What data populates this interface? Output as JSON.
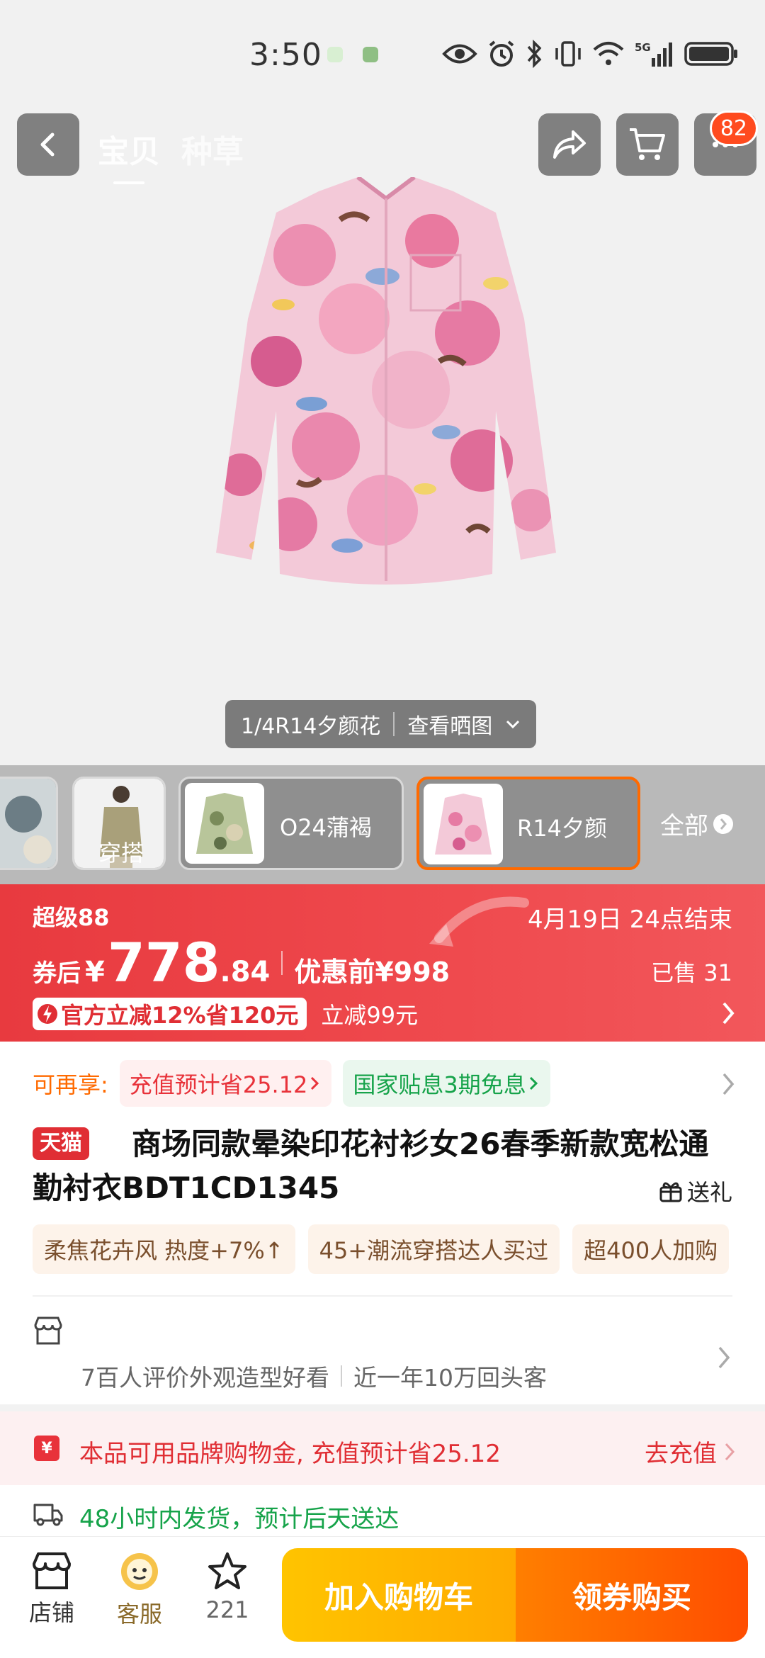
{
  "status_bar": {
    "time": "3:50",
    "network": "5G"
  },
  "top_nav": {
    "tabs": [
      "宝贝",
      "种草"
    ],
    "cart_badge": "82"
  },
  "gallery": {
    "indicator": "1/4R14夕颜花",
    "view_photos": "查看晒图"
  },
  "variants": {
    "items": [
      {
        "label": "穿搭"
      },
      {
        "label": "O24蒲褐"
      },
      {
        "label": "R14夕颜"
      }
    ],
    "all_label": "全部"
  },
  "price": {
    "promo_name": "超级88",
    "end_time": "4月19日 24点结束",
    "after_coupon": "券后",
    "currency": "¥",
    "integer": "778",
    "decimal": ".84",
    "before_discount": "优惠前¥998",
    "sold": "已售 31",
    "official_reduction": "官方立减12%省120元",
    "instant_reduction": "立减99元"
  },
  "offers": {
    "label": "可再享:",
    "chips": [
      "充值预计省25.12",
      "国家贴息3期免息"
    ]
  },
  "product": {
    "store_badge": "天猫",
    "title": "商场同款晕染印花衬衫女26春季新款宽松通勤衬衣BDT1CD1345",
    "gift_label": "送礼",
    "tags": [
      "柔焦花卉风 热度+7%↑",
      "45+潮流穿搭达人买过",
      "超400人加购"
    ]
  },
  "reviews": {
    "summary": "7百人评价外观造型好看",
    "repeat": "近一年10万回头客"
  },
  "recharge": {
    "icon_text": "¥",
    "text": "本品可用品牌购物金, 充值预计省25.12",
    "action": "去充值"
  },
  "shipping": {
    "text": "48小时内发货，预计后天送达"
  },
  "bottom_bar": {
    "store": "店铺",
    "service": "客服",
    "favorites": "221",
    "add_to_cart": "加入购物车",
    "buy": "领券购买"
  },
  "colors": {
    "price_banner": "#e83a3f",
    "accent_orange": "#ff6a00",
    "tmall_red": "#e02e34",
    "ship_green": "#16a34a"
  }
}
